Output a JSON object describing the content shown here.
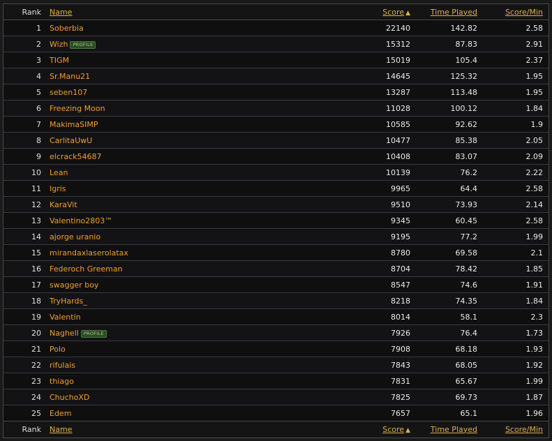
{
  "columns": {
    "rank": "Rank",
    "name": "Name",
    "score": "Score",
    "score_arrow": "▲",
    "time_played": "Time Played",
    "score_min": "Score/Min"
  },
  "badge_label": "PROFILE",
  "colors": {
    "name_link": "#f0a030",
    "header_link": "#e0b050",
    "badge_text": "#9fd48a",
    "badge_bg": "#2c4a26"
  },
  "rows": [
    {
      "rank": "1",
      "name": "Soberbia",
      "profile": false,
      "score": "22140",
      "time": "142.82",
      "spm": "2.58"
    },
    {
      "rank": "2",
      "name": "Wizh",
      "profile": true,
      "score": "15312",
      "time": "87.83",
      "spm": "2.91"
    },
    {
      "rank": "3",
      "name": "TIGM",
      "profile": false,
      "score": "15019",
      "time": "105.4",
      "spm": "2.37"
    },
    {
      "rank": "4",
      "name": "Sr.Manu21",
      "profile": false,
      "score": "14645",
      "time": "125.32",
      "spm": "1.95"
    },
    {
      "rank": "5",
      "name": "seben107",
      "profile": false,
      "score": "13287",
      "time": "113.48",
      "spm": "1.95"
    },
    {
      "rank": "6",
      "name": "Freezing Moon",
      "profile": false,
      "score": "11028",
      "time": "100.12",
      "spm": "1.84"
    },
    {
      "rank": "7",
      "name": "MakimaSIMP",
      "profile": false,
      "score": "10585",
      "time": "92.62",
      "spm": "1.9"
    },
    {
      "rank": "8",
      "name": "CarlitaUwU",
      "profile": false,
      "score": "10477",
      "time": "85.38",
      "spm": "2.05"
    },
    {
      "rank": "9",
      "name": "elcrack54687",
      "profile": false,
      "score": "10408",
      "time": "83.07",
      "spm": "2.09"
    },
    {
      "rank": "10",
      "name": "Lean",
      "profile": false,
      "score": "10139",
      "time": "76.2",
      "spm": "2.22"
    },
    {
      "rank": "11",
      "name": "Igris",
      "profile": false,
      "score": "9965",
      "time": "64.4",
      "spm": "2.58"
    },
    {
      "rank": "12",
      "name": "KaraVit",
      "profile": false,
      "score": "9510",
      "time": "73.93",
      "spm": "2.14"
    },
    {
      "rank": "13",
      "name": "Valentino2803™",
      "profile": false,
      "score": "9345",
      "time": "60.45",
      "spm": "2.58"
    },
    {
      "rank": "14",
      "name": "ajorge uranio",
      "profile": false,
      "score": "9195",
      "time": "77.2",
      "spm": "1.99"
    },
    {
      "rank": "15",
      "name": "mirandaxlaserolatax",
      "profile": false,
      "score": "8780",
      "time": "69.58",
      "spm": "2.1"
    },
    {
      "rank": "16",
      "name": "Federoch Greeman",
      "profile": false,
      "score": "8704",
      "time": "78.42",
      "spm": "1.85"
    },
    {
      "rank": "17",
      "name": "swagger boy",
      "profile": false,
      "score": "8547",
      "time": "74.6",
      "spm": "1.91"
    },
    {
      "rank": "18",
      "name": "TryHards_",
      "profile": false,
      "score": "8218",
      "time": "74.35",
      "spm": "1.84"
    },
    {
      "rank": "19",
      "name": "Valentín",
      "profile": false,
      "score": "8014",
      "time": "58.1",
      "spm": "2.3"
    },
    {
      "rank": "20",
      "name": "Naghell",
      "profile": true,
      "score": "7926",
      "time": "76.4",
      "spm": "1.73"
    },
    {
      "rank": "21",
      "name": "Polo",
      "profile": false,
      "score": "7908",
      "time": "68.18",
      "spm": "1.93"
    },
    {
      "rank": "22",
      "name": "rifulais",
      "profile": false,
      "score": "7843",
      "time": "68.05",
      "spm": "1.92"
    },
    {
      "rank": "23",
      "name": "thiago",
      "profile": false,
      "score": "7831",
      "time": "65.67",
      "spm": "1.99"
    },
    {
      "rank": "24",
      "name": "ChuchoXD",
      "profile": false,
      "score": "7825",
      "time": "69.73",
      "spm": "1.87"
    },
    {
      "rank": "25",
      "name": "Edem",
      "profile": false,
      "score": "7657",
      "time": "65.1",
      "spm": "1.96"
    }
  ]
}
